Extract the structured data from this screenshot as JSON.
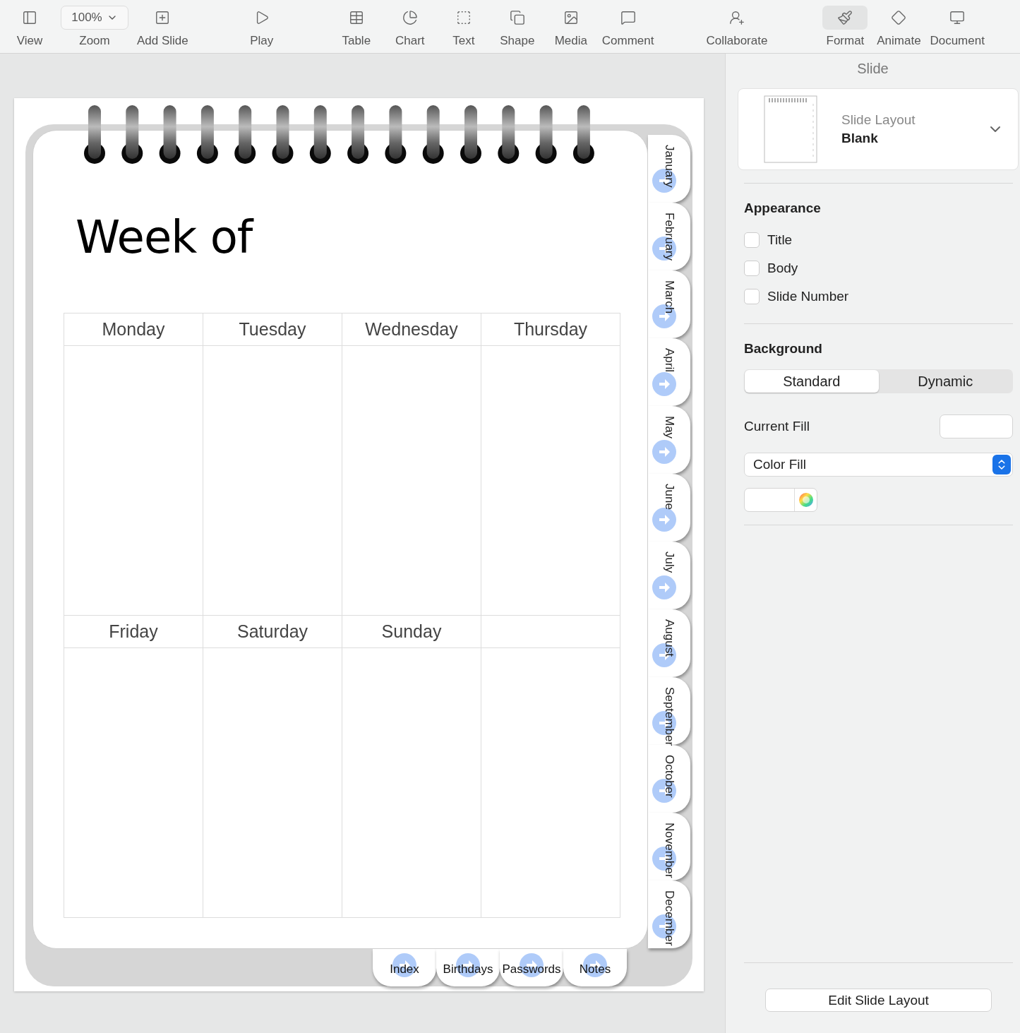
{
  "toolbar": {
    "groups": [
      [
        {
          "kind": "view",
          "label": "View"
        },
        {
          "kind": "zoom",
          "label": "Zoom",
          "value": "100%"
        },
        {
          "kind": "addslide",
          "label": "Add Slide"
        }
      ],
      [
        {
          "kind": "play",
          "label": "Play"
        }
      ],
      [
        {
          "kind": "table",
          "label": "Table"
        },
        {
          "kind": "chart",
          "label": "Chart"
        },
        {
          "kind": "text",
          "label": "Text"
        },
        {
          "kind": "shape",
          "label": "Shape"
        },
        {
          "kind": "media",
          "label": "Media"
        },
        {
          "kind": "comment",
          "label": "Comment"
        }
      ],
      [
        {
          "kind": "collaborate",
          "label": "Collaborate"
        }
      ],
      [
        {
          "kind": "format",
          "label": "Format",
          "selected": true
        },
        {
          "kind": "animate",
          "label": "Animate",
          "selected": false
        },
        {
          "kind": "document",
          "label": "Document",
          "selected": false
        }
      ]
    ]
  },
  "slide": {
    "title": "Week of",
    "days": [
      "Monday",
      "Tuesday",
      "Wednesday",
      "Thursday",
      "Friday",
      "Saturday",
      "Sunday"
    ],
    "side_tabs": [
      "January",
      "February",
      "March",
      "April",
      "May",
      "June",
      "July",
      "August",
      "September",
      "October",
      "November",
      "December"
    ],
    "bottom_tabs": [
      "Index",
      "Birthdays",
      "Passwords",
      "Notes"
    ]
  },
  "inspector": {
    "title": "Slide",
    "layout": {
      "label": "Slide Layout",
      "value": "Blank"
    },
    "appearance": {
      "heading": "Appearance",
      "items": [
        {
          "label": "Title",
          "checked": false
        },
        {
          "label": "Body",
          "checked": false
        },
        {
          "label": "Slide Number",
          "checked": false
        }
      ]
    },
    "background": {
      "heading": "Background",
      "options": [
        {
          "label": "Standard",
          "selected": true
        },
        {
          "label": "Dynamic",
          "selected": false
        }
      ],
      "current_fill_label": "Current Fill",
      "fill_type": "Color Fill"
    },
    "edit_button": "Edit Slide Layout"
  }
}
